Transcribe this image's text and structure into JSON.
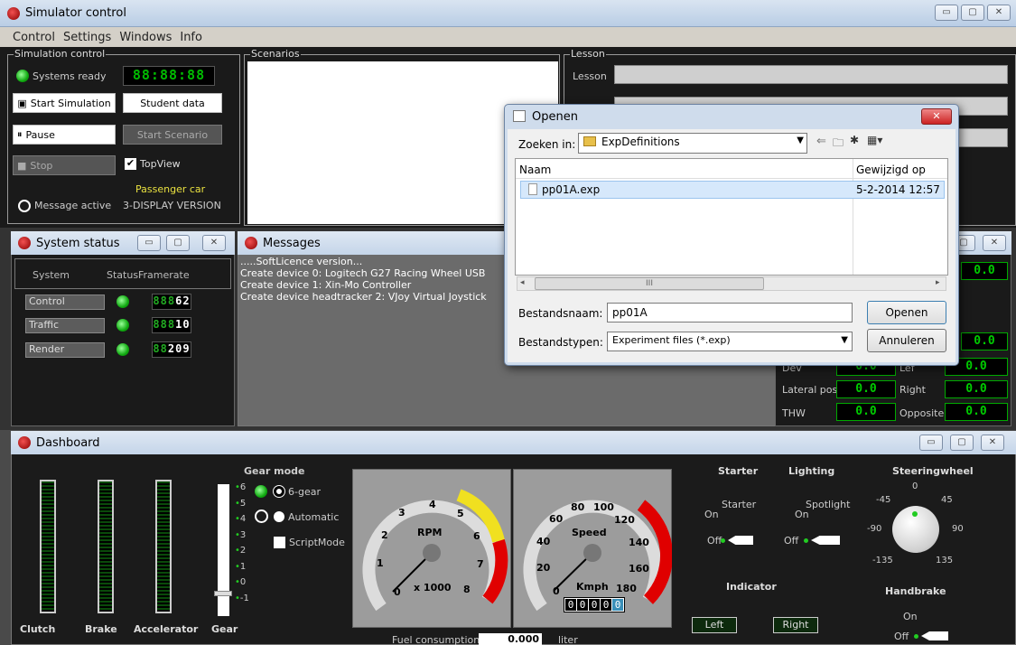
{
  "app": {
    "title": "Simulator control",
    "controls": [
      "▭",
      "▢",
      "✕"
    ]
  },
  "menu": [
    "Control",
    "Settings",
    "Windows",
    "Info"
  ],
  "sim": {
    "group": "Simulation control",
    "systems_ready": "Systems ready",
    "clock": "88:88:88",
    "start": "Start Simulation",
    "student": "Student data",
    "pause": "Pause",
    "start_scenario": "Start Scenario",
    "stop": "Stop",
    "topview": "TopView",
    "car": "Passenger car",
    "version": "3-DISPLAY VERSION",
    "message_active": "Message active"
  },
  "scenarios": {
    "group": "Scenarios"
  },
  "lesson": {
    "group": "Lesson",
    "label": "Lesson"
  },
  "sysstatus": {
    "title": "System status",
    "col_system": "System",
    "col_status": "Status",
    "col_framerate": "Framerate",
    "rows": [
      {
        "name": "Control",
        "dim": "888",
        "val": "62"
      },
      {
        "name": "Traffic",
        "dim": "888",
        "val": "10"
      },
      {
        "name": "Render",
        "dim": "88",
        "val": "209"
      }
    ]
  },
  "messages": {
    "title": "Messages",
    "lines": [
      ".....SoftLicence version...",
      "Create device 0: Logitech G27 Racing Wheel USB",
      "Create device 1: Xin-Mo Controller",
      "Create device headtracker 2: VJoy Virtual Joystick"
    ]
  },
  "rightpanel": {
    "lateral": "Lateral pos",
    "right": "Right",
    "thw": "THW",
    "opposite": "Opposite",
    "dev_label": "Dev",
    "left_label": "Lef",
    "digits": "0.0"
  },
  "dialog": {
    "title": "Openen",
    "lookin_label": "Zoeken in:",
    "lookin_value": "ExpDefinitions",
    "col_name": "Naam",
    "col_date": "Gewijzigd op",
    "file_name": "pp01A.exp",
    "file_date": "5-2-2014 12:57",
    "fname_label": "Bestandsnaam:",
    "fname_value": "pp01A",
    "ftype_label": "Bestandstypen:",
    "ftype_value": "Experiment files (*.exp)",
    "open": "Openen",
    "cancel": "Annuleren",
    "scroll_mid": "III"
  },
  "dash": {
    "title": "Dashboard",
    "clutch": "Clutch",
    "brake": "Brake",
    "accelerator": "Accelerator",
    "gear": "Gear",
    "gear_mode": "Gear mode",
    "six_gear": "6-gear",
    "automatic": "Automatic",
    "scriptmode": "ScriptMode",
    "gears": [
      "6",
      "5",
      "4",
      "3",
      "2",
      "1",
      "0",
      "-1"
    ],
    "rpm_label": "RPM",
    "rpm_unit": "x 1000",
    "rpm_ticks": [
      "0",
      "1",
      "2",
      "3",
      "4",
      "5",
      "6",
      "7",
      "8"
    ],
    "speed_label": "Speed",
    "speed_unit": "Kmph",
    "speed_ticks": [
      "0",
      "20",
      "40",
      "60",
      "80",
      "100",
      "120",
      "140",
      "160",
      "180"
    ],
    "speed_digits": "",
    "odometer": [
      "0",
      "0",
      "0",
      "0",
      "0"
    ],
    "fuel_label": "Fuel consumption",
    "fuel_value": "0.000",
    "fuel_unit": "liter",
    "starter_h": "Starter",
    "lighting_h": "Lighting",
    "steering_h": "Steeringwheel",
    "starter": "Starter",
    "spotlight": "Spotlight",
    "on": "On",
    "off": "Off",
    "indicator": "Indicator",
    "left": "Left",
    "right": "Right",
    "handbrake": "Handbrake",
    "steer_ticks": [
      "0",
      "45",
      "90",
      "135",
      "-135",
      "-90",
      "-45"
    ]
  },
  "colors": {
    "accent_green": "#22cc22",
    "gauge_red": "#e00000",
    "gauge_yellow": "#f0e020"
  }
}
